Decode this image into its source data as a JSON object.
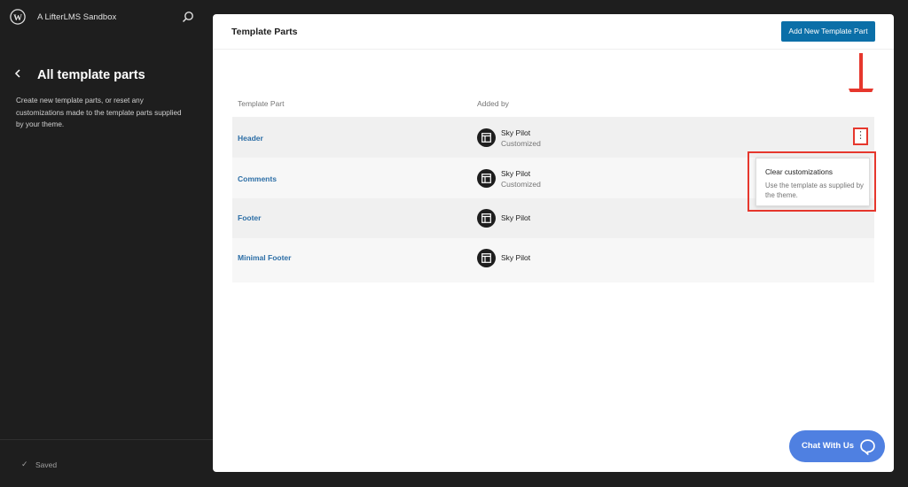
{
  "sidebar": {
    "site_name": "A LifterLMS Sandbox",
    "title": "All template parts",
    "description": "Create new template parts, or reset any customizations made to the template parts supplied by your theme.",
    "saved_label": "Saved"
  },
  "main": {
    "title": "Template Parts",
    "add_button_label": "Add New Template Part",
    "table": {
      "headers": [
        "Template Part",
        "Added by"
      ],
      "rows": [
        {
          "name": "Header",
          "author": "Sky Pilot",
          "status": "Customized"
        },
        {
          "name": "Comments",
          "author": "Sky Pilot",
          "status": "Customized"
        },
        {
          "name": "Footer",
          "author": "Sky Pilot",
          "status": ""
        },
        {
          "name": "Minimal Footer",
          "author": "Sky Pilot",
          "status": ""
        }
      ]
    },
    "more_menu_glyph": "⋮",
    "popover": {
      "title": "Clear customizations",
      "description": "Use the template as supplied by the theme."
    },
    "chat_label": "Chat With Us"
  },
  "colors": {
    "accent": "#0b6fa8",
    "link": "#2c6ea6",
    "annotation": "#e6372d",
    "chat": "#4f80e1"
  }
}
